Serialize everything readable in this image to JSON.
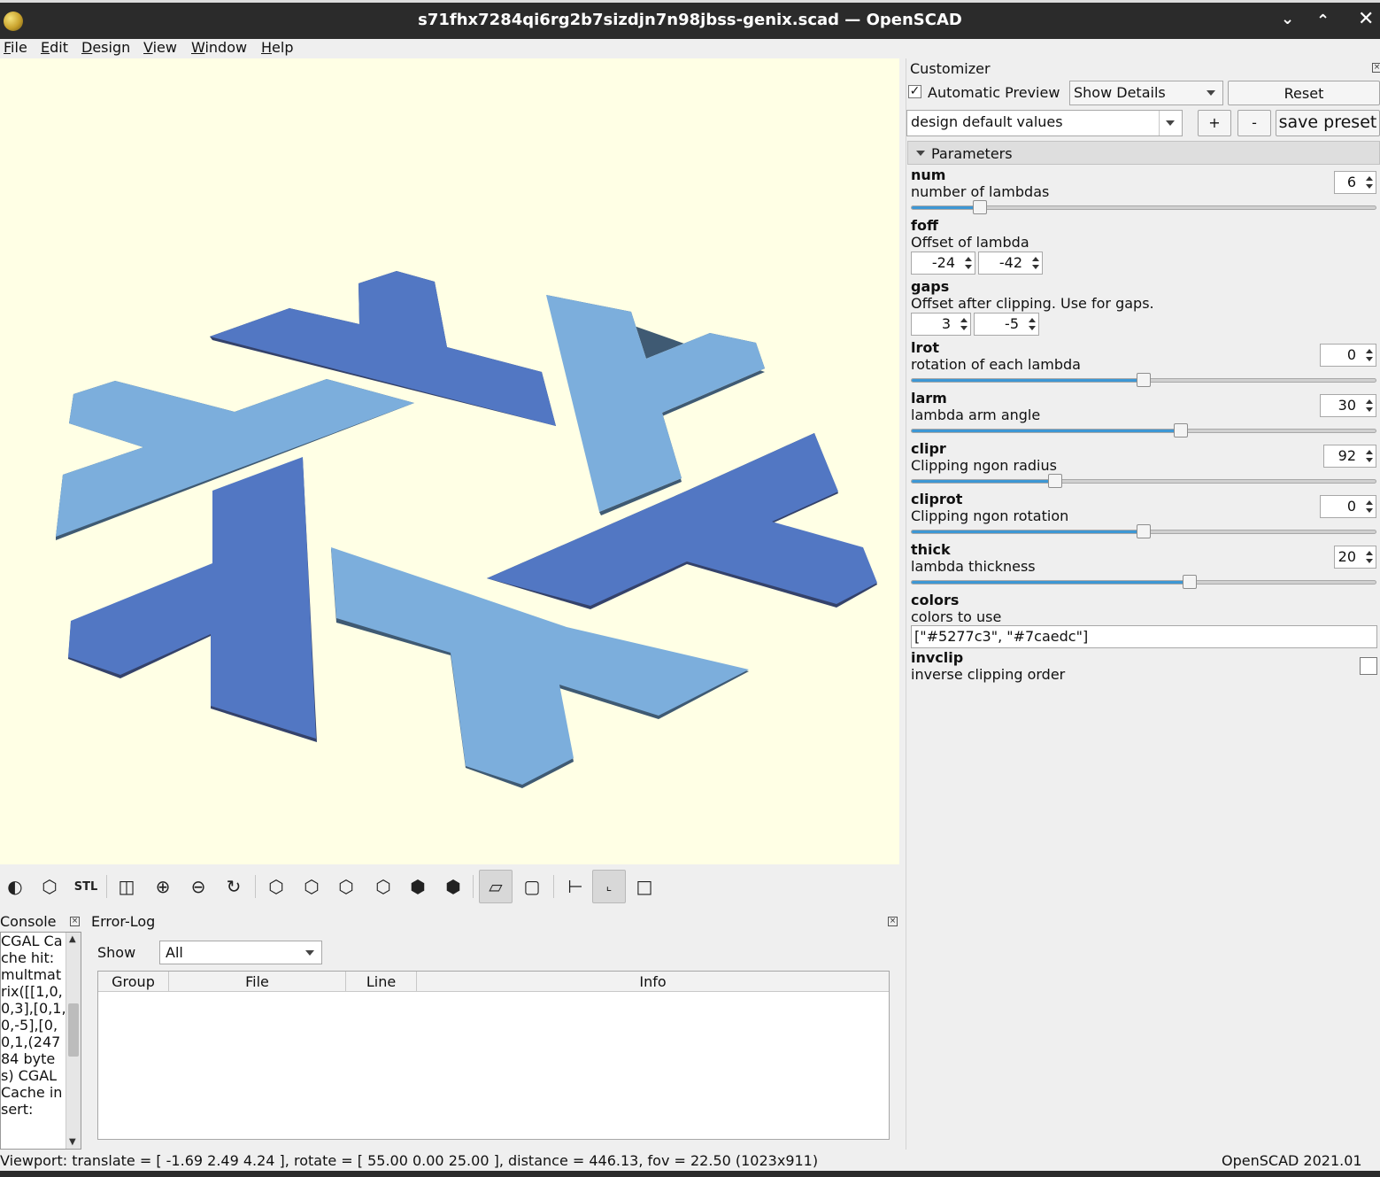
{
  "window": {
    "title": "s71fhx7284qi6rg2b7sizdjn7n98jbss-genix.scad — OpenSCAD"
  },
  "menu": [
    "File",
    "Edit",
    "Design",
    "View",
    "Window",
    "Help"
  ],
  "viewport": {
    "background": "#ffffe5",
    "colors": [
      "#5277c3",
      "#7caedc"
    ]
  },
  "console": {
    "title": "Console",
    "text": "CGAL Cache hit: multmatrix([[1,0,0,3],[0,1,0,-5],[0,0,1,(24784 bytes) CGAL Cache insert:"
  },
  "errorlog": {
    "title": "Error-Log",
    "show_label": "Show",
    "show_value": "All",
    "columns": [
      "Group",
      "File",
      "Line",
      "Info"
    ]
  },
  "status": {
    "viewport_text": "Viewport: translate = [ -1.69 2.49 4.24 ], rotate = [ 55.00 0.00 25.00 ], distance = 446.13, fov = 22.50 (1023x911)",
    "version": "OpenSCAD 2021.01"
  },
  "customizer": {
    "title": "Customizer",
    "auto_preview_label": "Automatic Preview",
    "auto_preview_checked": true,
    "details_value": "Show Details",
    "reset_label": "Reset",
    "preset_value": "design default values",
    "plus_label": "+",
    "minus_label": "-",
    "save_preset_label": "save preset",
    "section_title": "Parameters",
    "params": {
      "num": {
        "name": "num",
        "desc": "number of lambdas",
        "value": "6",
        "slider_fraction": 0.147
      },
      "foff": {
        "name": "foff",
        "desc": "Offset of lambda",
        "value_x": "-24",
        "value_y": "-42"
      },
      "gaps": {
        "name": "gaps",
        "desc": "Offset after clipping. Use for gaps.",
        "value_x": "3",
        "value_y": "-5"
      },
      "lrot": {
        "name": "lrot",
        "desc": "rotation of each lambda",
        "value": "0",
        "slider_fraction": 0.5
      },
      "larm": {
        "name": "larm",
        "desc": "lambda arm angle",
        "value": "30",
        "slider_fraction": 0.58
      },
      "clipr": {
        "name": "clipr",
        "desc": "Clipping ngon radius",
        "value": "92",
        "slider_fraction": 0.31
      },
      "cliprot": {
        "name": "cliprot",
        "desc": "Clipping ngon rotation",
        "value": "0",
        "slider_fraction": 0.5
      },
      "thick": {
        "name": "thick",
        "desc": "lambda thickness",
        "value": "20",
        "slider_fraction": 0.6
      },
      "colors": {
        "name": "colors",
        "desc": "colors to use",
        "value": "[\"#5277c3\", \"#7caedc\"]"
      },
      "invclip": {
        "name": "invclip",
        "desc": "inverse clipping order",
        "checked": false
      }
    }
  }
}
